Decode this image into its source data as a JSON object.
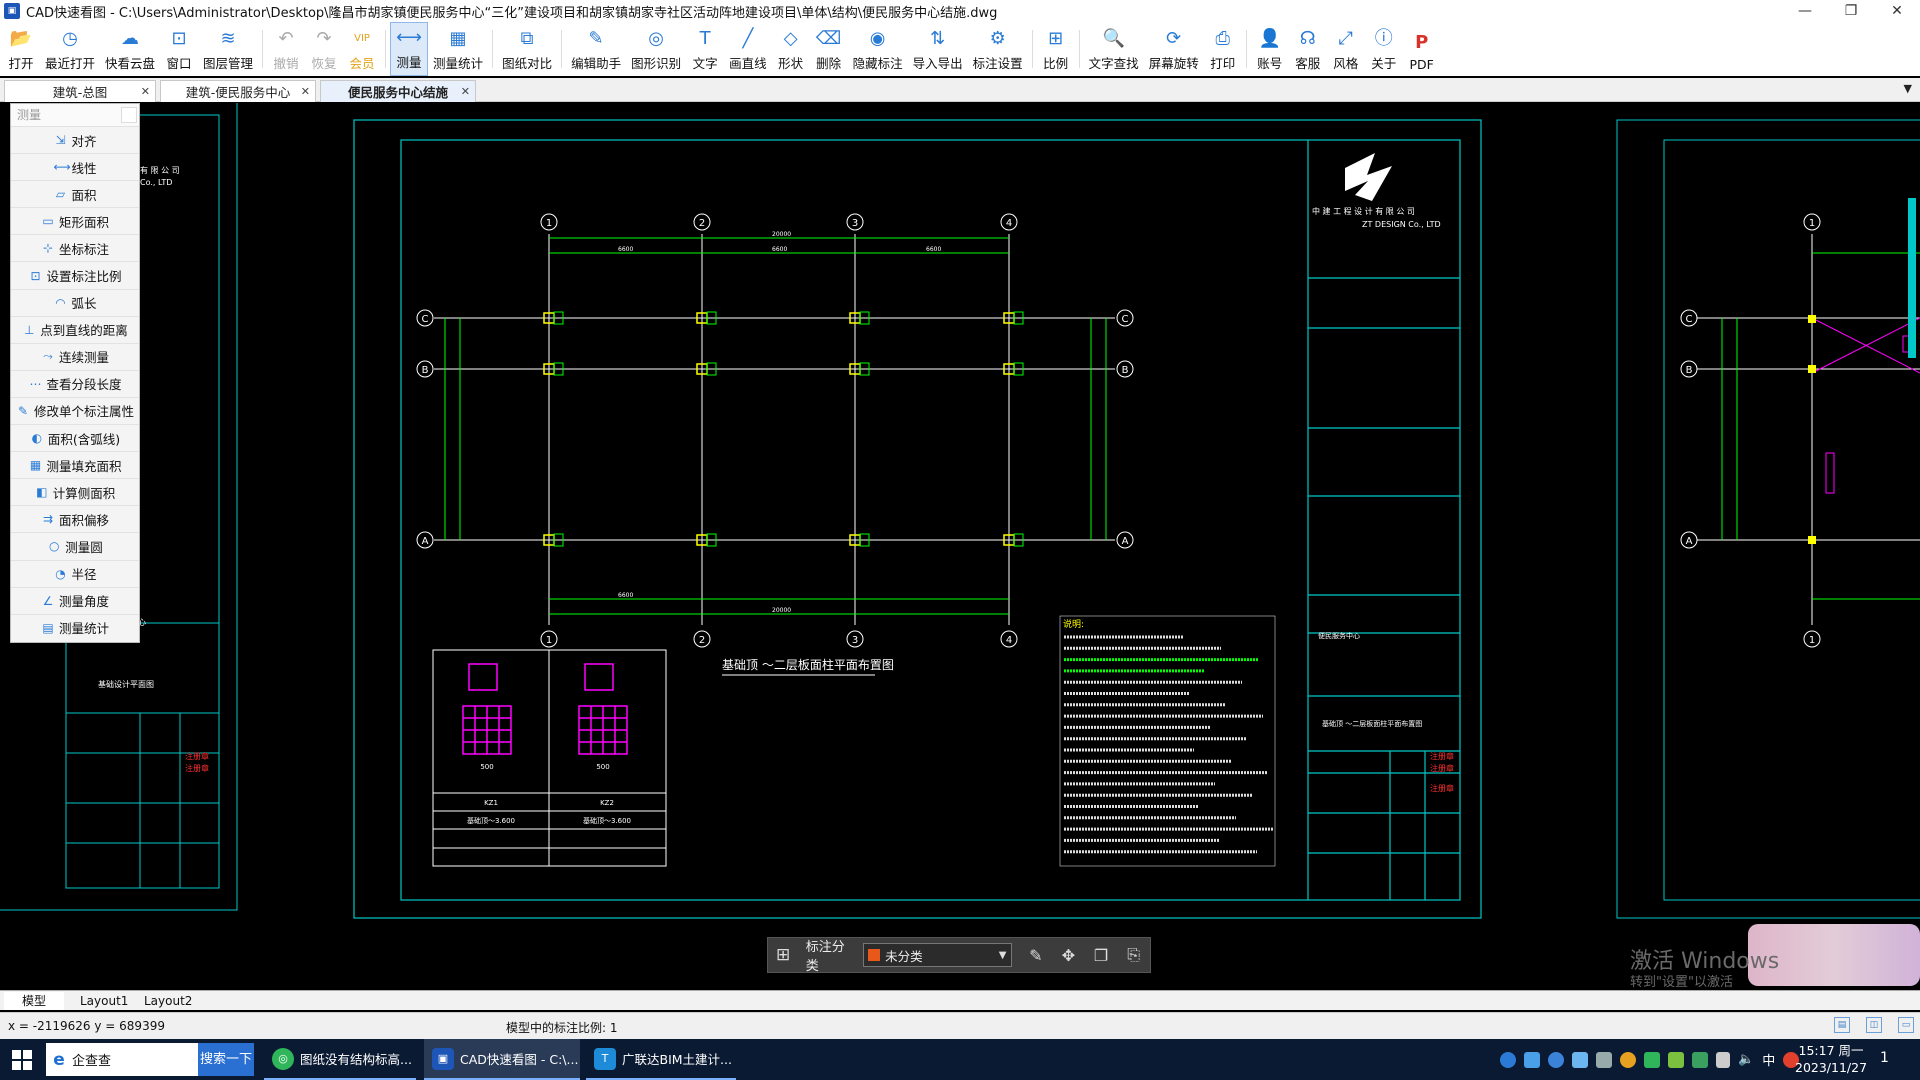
{
  "window": {
    "title": "CAD快速看图 - C:\\Users\\Administrator\\Desktop\\隆昌市胡家镇便民服务中心“三化”建设项目和胡家镇胡家寺社区活动阵地建设项目\\单体\\结构\\便民服务中心结施.dwg",
    "controls": [
      "—",
      "❐",
      "✕"
    ]
  },
  "toolbar": {
    "items": [
      {
        "label": "打开",
        "icon": "folder-open-icon",
        "glyph": "📂"
      },
      {
        "label": "最近打开",
        "icon": "recent-clock-icon",
        "glyph": "◷"
      },
      {
        "label": "快看云盘",
        "icon": "cloud-icon",
        "glyph": "☁"
      },
      {
        "label": "窗口",
        "icon": "window-icon",
        "glyph": "⊡"
      },
      {
        "label": "图层管理",
        "icon": "layers-icon",
        "glyph": "≋"
      },
      {
        "label": "撤销",
        "icon": "undo-icon",
        "glyph": "↶"
      },
      {
        "label": "恢复",
        "icon": "redo-icon",
        "glyph": "↷"
      },
      {
        "label": "会员",
        "icon": "vip-icon",
        "glyph": "VIP"
      },
      {
        "label": "测量",
        "icon": "ruler-icon",
        "glyph": "⟷"
      },
      {
        "label": "测量统计",
        "icon": "measure-stats-icon",
        "glyph": "▦"
      },
      {
        "label": "图纸对比",
        "icon": "compare-icon",
        "glyph": "⧉"
      },
      {
        "label": "编辑助手",
        "icon": "edit-assistant-icon",
        "glyph": "✎"
      },
      {
        "label": "图形识别",
        "icon": "shape-recognition-icon",
        "glyph": "◎"
      },
      {
        "label": "文字",
        "icon": "text-icon",
        "glyph": "T"
      },
      {
        "label": "画直线",
        "icon": "line-icon",
        "glyph": "╱"
      },
      {
        "label": "形状",
        "icon": "shape-icon",
        "glyph": "◇"
      },
      {
        "label": "删除",
        "icon": "eraser-icon",
        "glyph": "⌫"
      },
      {
        "label": "隐藏标注",
        "icon": "hide-annotation-icon",
        "glyph": "◉"
      },
      {
        "label": "导入导出",
        "icon": "import-export-icon",
        "glyph": "⇅"
      },
      {
        "label": "标注设置",
        "icon": "annotation-settings-icon",
        "glyph": "⚙"
      },
      {
        "label": "比例",
        "icon": "scale-icon",
        "glyph": "⊞"
      },
      {
        "label": "文字查找",
        "icon": "text-search-icon",
        "glyph": "🔍"
      },
      {
        "label": "屏幕旋转",
        "icon": "rotate-screen-icon",
        "glyph": "⟳"
      },
      {
        "label": "打印",
        "icon": "printer-icon",
        "glyph": "⎙"
      },
      {
        "label": "账号",
        "icon": "account-icon",
        "glyph": "👤"
      },
      {
        "label": "客服",
        "icon": "headset-icon",
        "glyph": "☊"
      },
      {
        "label": "风格",
        "icon": "style-icon",
        "glyph": "⤢"
      },
      {
        "label": "关于",
        "icon": "info-icon",
        "glyph": "ⓘ"
      },
      {
        "label": "PDF",
        "icon": "pdf-icon",
        "glyph": "P"
      }
    ],
    "active": "测量"
  },
  "tabs": [
    {
      "label": "建筑-总图"
    },
    {
      "label": "建筑-便民服务中心"
    },
    {
      "label": "便民服务中心结施"
    }
  ],
  "measure_panel": {
    "title": "测量",
    "items": [
      {
        "label": "对齐",
        "icon": "align-measure-icon"
      },
      {
        "label": "线性",
        "icon": "linear-measure-icon"
      },
      {
        "label": "面积",
        "icon": "area-icon"
      },
      {
        "label": "矩形面积",
        "icon": "rect-area-icon"
      },
      {
        "label": "坐标标注",
        "icon": "coordinate-icon"
      },
      {
        "label": "设置标注比例",
        "icon": "set-scale-icon"
      },
      {
        "label": "弧长",
        "icon": "arc-length-icon"
      },
      {
        "label": "点到直线的距离",
        "icon": "point-line-distance-icon"
      },
      {
        "label": "连续测量",
        "icon": "continuous-measure-icon"
      },
      {
        "label": "查看分段长度",
        "icon": "segment-length-icon"
      },
      {
        "label": "修改单个标注属性",
        "icon": "edit-annotation-icon"
      },
      {
        "label": "面积(含弧线)",
        "icon": "arc-area-icon"
      },
      {
        "label": "测量填充面积",
        "icon": "fill-area-icon"
      },
      {
        "label": "计算侧面积",
        "icon": "side-area-icon"
      },
      {
        "label": "面积偏移",
        "icon": "area-offset-icon"
      },
      {
        "label": "测量圆",
        "icon": "measure-circle-icon"
      },
      {
        "label": "半径",
        "icon": "radius-icon"
      },
      {
        "label": "测量角度",
        "icon": "angle-icon"
      },
      {
        "label": "测量统计",
        "icon": "measure-stats-icon"
      }
    ]
  },
  "drawing": {
    "grid_cols": [
      "1",
      "2",
      "3",
      "4"
    ],
    "grid_rows": [
      "C",
      "B",
      "A"
    ],
    "dim_total": "20000",
    "dim_segments": [
      "6600",
      "6600",
      "6600"
    ],
    "plan_title": "基础顶 ～二层板面柱平面布置图",
    "column_table": {
      "names": [
        "KZ1",
        "KZ2"
      ],
      "sizes": [
        "500",
        "500"
      ],
      "elev": [
        "基础顶～3.600",
        "基础顶～3.600"
      ]
    },
    "notes_title": "说明:",
    "company": {
      "name_cn": "中 建 工 程 设 计 有 限 公 司",
      "name_en": "ZT DESIGN Co., LTD"
    },
    "colors": {
      "frame": "#00c8c8",
      "grid": "#ffffff",
      "column": "#ffff00",
      "rebar": "#00ff00",
      "magenta": "#ff00ff",
      "red": "#ff3030"
    }
  },
  "annotation_bar": {
    "label": "标注分类",
    "selected": "未分类",
    "swatch": "#e8581a"
  },
  "layout_tabs": [
    "模型",
    "Layout1",
    "Layout2"
  ],
  "status": {
    "coords": "x = -2119626  y = 689399",
    "scale_text": "模型中的标注比例: 1"
  },
  "watermark": {
    "line1": "激活 Windows",
    "line2": "转到\"设置\"以激活"
  },
  "taskbar": {
    "search_text": "企查查",
    "search_button": "搜索一下",
    "apps": [
      {
        "label": "图纸没有结构标高...",
        "color": "#2fb55a"
      },
      {
        "label": "CAD快速看图 - C:\\...",
        "color": "#1e56b8"
      },
      {
        "label": "广联达BIM土建计...",
        "color": "#1d8bd8"
      }
    ],
    "ime": "中",
    "time": "15:17 周一",
    "date": "2023/11/27",
    "notifications": "1"
  }
}
